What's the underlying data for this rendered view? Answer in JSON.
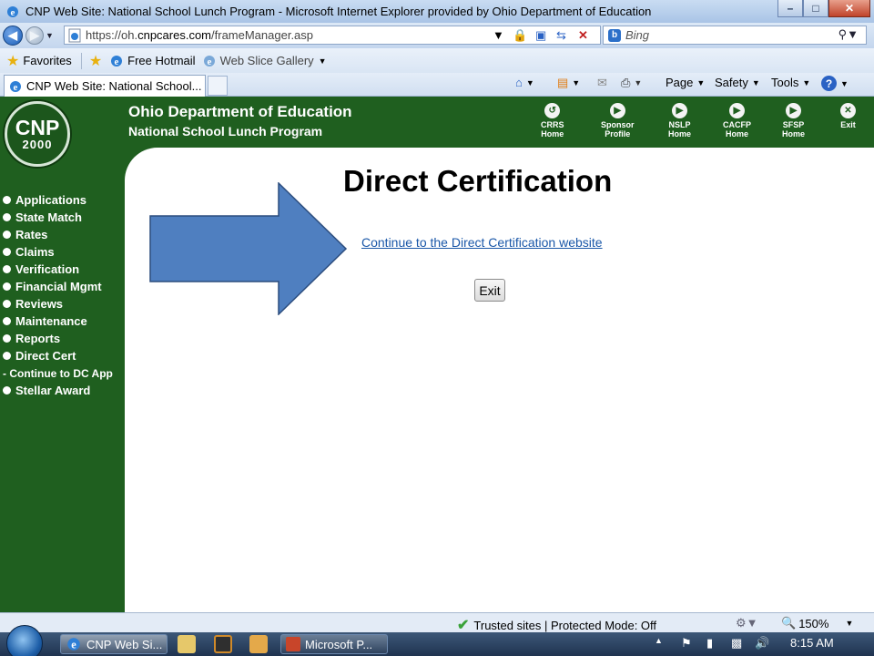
{
  "window": {
    "title": "CNP Web Site: National School Lunch Program - Microsoft Internet Explorer provided by Ohio Department of Education",
    "minimize": "–",
    "maximize": "□",
    "close": "✕"
  },
  "address_bar": {
    "url_prefix": "https://oh.",
    "url_domain": "cnpcares.com",
    "url_path": "/frameManager.asp",
    "search_placeholder": "Bing"
  },
  "favorites_bar": {
    "favorites_label": "Favorites",
    "items": [
      {
        "label": "Free Hotmail",
        "icon": "ie-page-icon"
      },
      {
        "label": "Web Slice Gallery",
        "icon": "ie-page-icon"
      }
    ]
  },
  "tab": {
    "label": "CNP Web Site: National School..."
  },
  "command_bar": {
    "page": "Page",
    "safety": "Safety",
    "tools": "Tools",
    "help": "?"
  },
  "site": {
    "logo_top": "CNP",
    "logo_bottom": "2000",
    "org_line1": "Ohio Department of Education",
    "org_line2": "National School Lunch Program",
    "top_nav": [
      {
        "line1": "CRRS",
        "line2": "Home",
        "icon": "↺"
      },
      {
        "line1": "Sponsor",
        "line2": "Profile",
        "icon": "▶"
      },
      {
        "line1": "NSLP",
        "line2": "Home",
        "icon": "▶"
      },
      {
        "line1": "CACFP",
        "line2": "Home",
        "icon": "▶"
      },
      {
        "line1": "SFSP",
        "line2": "Home",
        "icon": "▶"
      },
      {
        "line1": "Exit",
        "line2": "",
        "icon": "✕"
      }
    ],
    "side_nav": [
      "Applications",
      "State Match",
      "Rates",
      "Claims",
      "Verification",
      "Financial Mgmt",
      "Reviews",
      "Maintenance",
      "Reports",
      "Direct Cert"
    ],
    "side_nav_sub": "- Continue to DC App",
    "side_nav_last": "Stellar Award",
    "colors": {
      "brand_green": "#1f5f1f",
      "arrow_blue": "#4f7fc0",
      "link_blue": "#1a57a8"
    }
  },
  "main": {
    "heading": "Direct Certification",
    "link": "Continue to the Direct Certification website",
    "exit_button": "Exit"
  },
  "status_bar": {
    "zone": "Trusted sites | Protected Mode: Off",
    "zoom": "150%"
  },
  "taskbar": {
    "items": [
      {
        "label": "CNP Web Si...",
        "icon": "ie-icon"
      },
      {
        "label": "Microsoft P...",
        "icon": "powerpoint-icon"
      }
    ],
    "clock": "8:15 AM"
  }
}
